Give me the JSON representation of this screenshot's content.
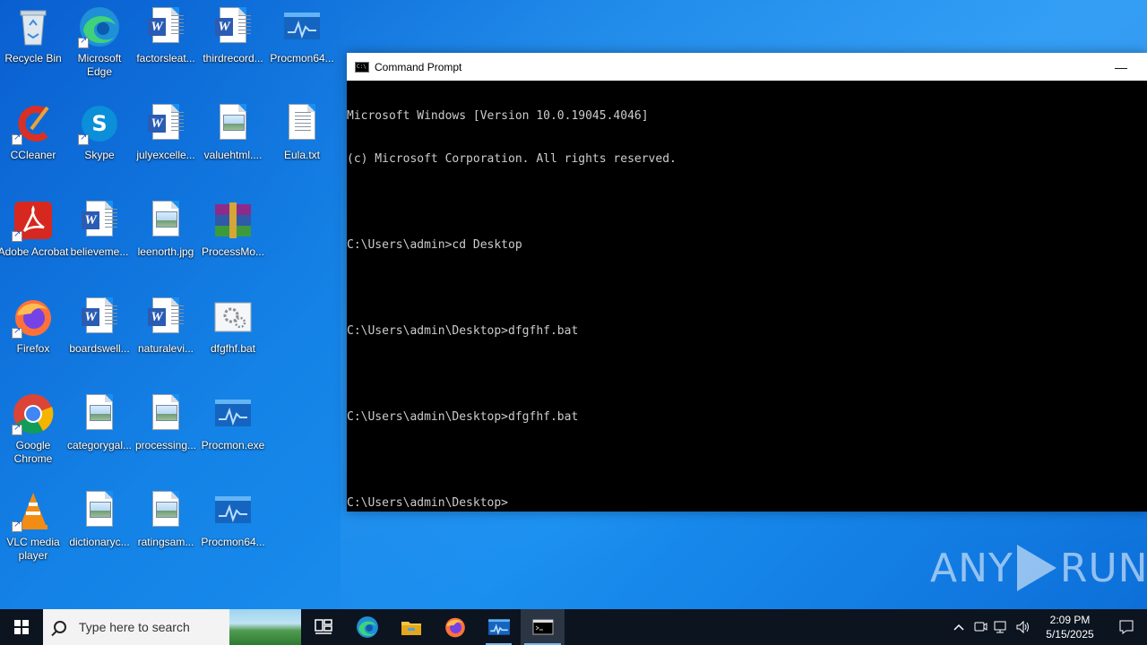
{
  "desktop": {
    "icons": [
      {
        "label": "Recycle Bin",
        "icon": "recycle-bin-icon"
      },
      {
        "label": "Microsoft Edge",
        "icon": "edge-icon"
      },
      {
        "label": "factorsleat...",
        "icon": "word-doc-icon"
      },
      {
        "label": "thirdrecord...",
        "icon": "word-doc-icon"
      },
      {
        "label": "Procmon64...",
        "icon": "procmon-icon"
      },
      {
        "label": "CCleaner",
        "icon": "ccleaner-icon"
      },
      {
        "label": "Skype",
        "icon": "skype-icon"
      },
      {
        "label": "julyexcelle...",
        "icon": "word-doc-icon"
      },
      {
        "label": "valuehtml....",
        "icon": "image-file-icon"
      },
      {
        "label": "Eula.txt",
        "icon": "text-file-icon"
      },
      {
        "label": "Adobe Acrobat",
        "icon": "acrobat-icon"
      },
      {
        "label": "believeme...",
        "icon": "word-doc-icon"
      },
      {
        "label": "leenorth.jpg",
        "icon": "image-file-icon"
      },
      {
        "label": "ProcessMo...",
        "icon": "winrar-icon"
      },
      {
        "label": "Firefox",
        "icon": "firefox-icon"
      },
      {
        "label": "boardswell...",
        "icon": "word-doc-icon"
      },
      {
        "label": "naturalevi...",
        "icon": "word-doc-icon"
      },
      {
        "label": "dfgfhf.bat",
        "icon": "batch-file-icon"
      },
      {
        "label": "Google Chrome",
        "icon": "chrome-icon"
      },
      {
        "label": "categorygal...",
        "icon": "image-file-icon"
      },
      {
        "label": "processing...",
        "icon": "image-file-icon"
      },
      {
        "label": "Procmon.exe",
        "icon": "procmon-icon"
      },
      {
        "label": "VLC media player",
        "icon": "vlc-icon"
      },
      {
        "label": "dictionaryc...",
        "icon": "image-file-icon"
      },
      {
        "label": "ratingsam...",
        "icon": "image-file-icon"
      },
      {
        "label": "Procmon64...",
        "icon": "procmon-icon"
      }
    ]
  },
  "cmd": {
    "title": "Command Prompt",
    "minimize_glyph": "—",
    "lines": [
      "Microsoft Windows [Version 10.0.19045.4046]",
      "(c) Microsoft Corporation. All rights reserved.",
      "",
      "C:\\Users\\admin>cd Desktop",
      "",
      "C:\\Users\\admin\\Desktop>dfgfhf.bat",
      "",
      "C:\\Users\\admin\\Desktop>dfgfhf.bat",
      "",
      "C:\\Users\\admin\\Desktop>"
    ]
  },
  "watermark": {
    "left": "ANY",
    "right": "RUN"
  },
  "taskbar": {
    "search_placeholder": "Type here to search",
    "apps": [
      "task-view-icon",
      "edge-icon",
      "file-explorer-icon",
      "firefox-icon",
      "procmon-icon",
      "cmd-icon"
    ],
    "clock_time": "2:09 PM",
    "clock_date": "5/15/2025"
  },
  "colors": {
    "desktop": "#1482e6",
    "taskbar": "#0c1420",
    "console_text": "#cccccc"
  }
}
